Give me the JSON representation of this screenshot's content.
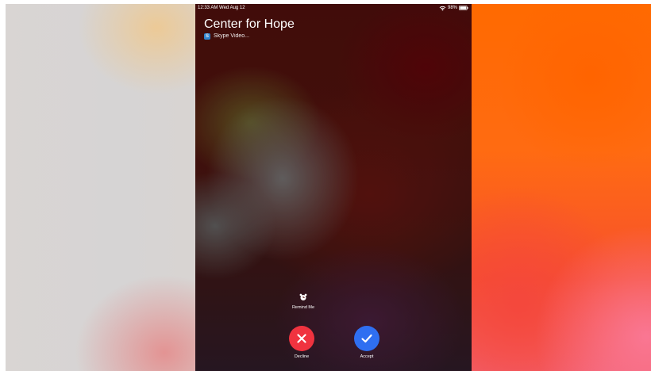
{
  "status_bar": {
    "time_date": "12:33 AM  Wed Aug 12",
    "battery": "98%",
    "icons": [
      "wifi-icon",
      "battery-icon"
    ]
  },
  "caller": {
    "name": "Center for Hope",
    "app_label": "Skype Video...",
    "app_icon": "skype-icon"
  },
  "remind": {
    "label": "Remind Me",
    "icon": "alarm-clock-icon"
  },
  "actions": {
    "decline_label": "Decline",
    "accept_label": "Accept",
    "decline_icon": "x-icon",
    "accept_icon": "checkmark-icon"
  },
  "colors": {
    "decline": "#f0333f",
    "accept": "#2f6ff1",
    "text": "#ffffff"
  }
}
